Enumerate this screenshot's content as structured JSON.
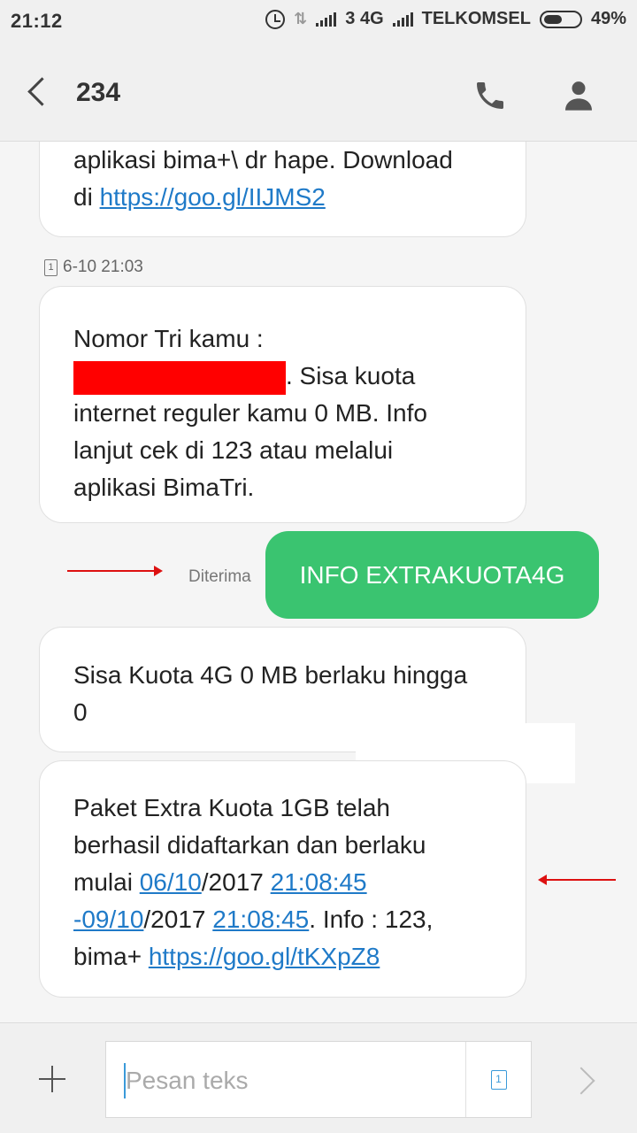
{
  "status_bar": {
    "time": "21:12",
    "sim_network": "3 4G",
    "carrier": "TELKOMSEL",
    "battery": "49%"
  },
  "header": {
    "title": "234"
  },
  "messages": {
    "first_partial": {
      "line1": "aplikasi bima+\\ dr hape. Download",
      "prefix": "di ",
      "link": "https://goo.gl/IIJMS2"
    },
    "timestamp": "6-10 21:03",
    "sim_label": "1",
    "second": {
      "line1": "Nomor Tri kamu :",
      "after_redact": ". Sisa kuota",
      "line3": "internet reguler kamu 0 MB. Info",
      "line4": "lanjut cek di 123 atau melalui",
      "line5": "aplikasi BimaTri."
    },
    "sent": {
      "text": "INFO EXTRAKUOTA4G",
      "status": "Diterima"
    },
    "third": {
      "line1": "Sisa Kuota 4G 0 MB berlaku hingga",
      "line2": "0"
    },
    "fourth": {
      "line1": "Paket Extra Kuota 1GB telah",
      "line2": "berhasil didaftarkan dan berlaku",
      "mulai": "mulai ",
      "date1": "06/10",
      "year1": "/2017 ",
      "time1": "21:08:45",
      "date2": "-09/10",
      "year2": "/2017 ",
      "time2": "21:08:45",
      "info": ". Info : 123,",
      "bima": "bima+ ",
      "link": "https://goo.gl/tKXpZ8"
    }
  },
  "composer": {
    "placeholder": "Pesan teks",
    "sim_label": "1"
  },
  "colors": {
    "sent_bubble": "#3ac470",
    "link": "#1f7ac8",
    "annotation_arrow": "#dd1111",
    "redaction": "#ff0000"
  }
}
